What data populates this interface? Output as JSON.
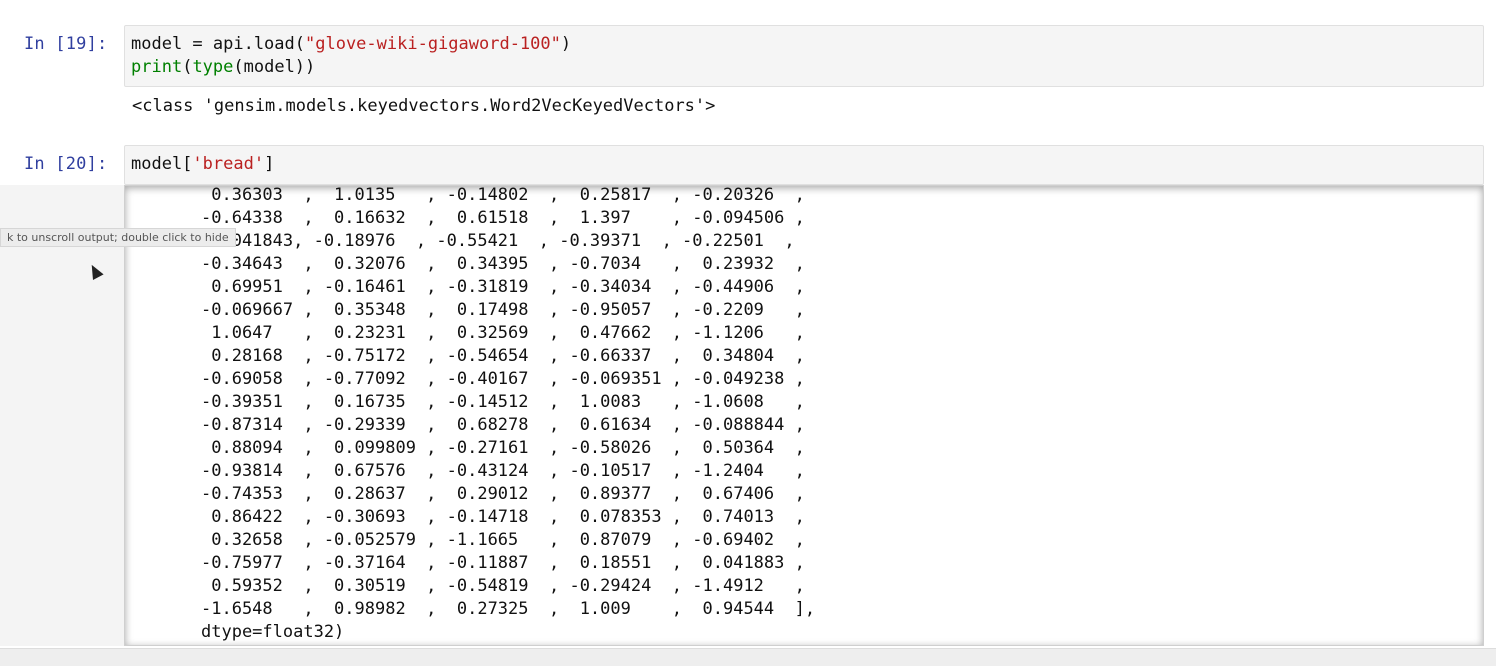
{
  "cell19": {
    "prompt": "In [19]:",
    "code_line1_pre": "model = api.load(",
    "code_line1_str": "\"glove-wiki-gigaword-100\"",
    "code_line1_post": ")",
    "code_line2_builtin1": "print",
    "code_line2_mid": "(",
    "code_line2_builtin2": "type",
    "code_line2_post": "(model))",
    "output": "<class 'gensim.models.keyedvectors.Word2VecKeyedVectors'>"
  },
  "cell20": {
    "prompt": "In [20]:",
    "code_pre": "model[",
    "code_str": "'bread'",
    "code_post": "]"
  },
  "tooltip": "k to unscroll output; double click to hide",
  "vector_lines": [
    " 0.36303  ,  1.0135   , -0.14802  ,  0.25817  , -0.20326  ,",
    "-0.64338  ,  0.16632  ,  0.61518  ,  1.397    , -0.094506 ,",
    "-0.041843, -0.18976  , -0.55421  , -0.39371  , -0.22501  ,",
    "-0.34643  ,  0.32076  ,  0.34395  , -0.7034   ,  0.23932  ,",
    " 0.69951  , -0.16461  , -0.31819  , -0.34034  , -0.44906  ,",
    "-0.069667 ,  0.35348  ,  0.17498  , -0.95057  , -0.2209   ,",
    " 1.0647   ,  0.23231  ,  0.32569  ,  0.47662  , -1.1206   ,",
    " 0.28168  , -0.75172  , -0.54654  , -0.66337  ,  0.34804  ,",
    "-0.69058  , -0.77092  , -0.40167  , -0.069351 , -0.049238 ,",
    "-0.39351  ,  0.16735  , -0.14512  ,  1.0083   , -1.0608   ,",
    "-0.87314  , -0.29339  ,  0.68278  ,  0.61634  , -0.088844 ,",
    " 0.88094  ,  0.099809 , -0.27161  , -0.58026  ,  0.50364  ,",
    "-0.93814  ,  0.67576  , -0.43124  , -0.10517  , -1.2404   ,",
    "-0.74353  ,  0.28637  ,  0.29012  ,  0.89377  ,  0.67406  ,",
    " 0.86422  , -0.30693  , -0.14718  ,  0.078353 ,  0.74013  ,",
    " 0.32658  , -0.052579 , -1.1665   ,  0.87079  , -0.69402  ,",
    "-0.75977  , -0.37164  , -0.11887  ,  0.18551  ,  0.041883 ,",
    " 0.59352  ,  0.30519  , -0.54819  , -0.29424  , -1.4912   ,",
    "-1.6548   ,  0.98982  ,  0.27325  ,  1.009    ,  0.94544  ],"
  ],
  "dtype_line": "dtype=float32)"
}
